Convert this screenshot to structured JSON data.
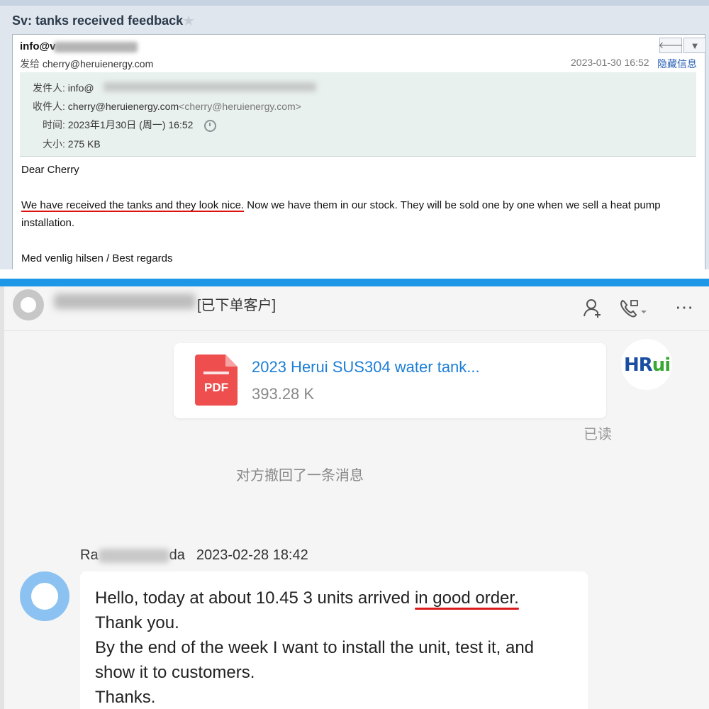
{
  "email": {
    "subject": "Sv: tanks received feedback",
    "from_addr_start": "info@v",
    "sender_label": "发给",
    "sender": "cherry@heruienergy.com",
    "datetime": "2023-01-30 16:52",
    "hide_info": "隐藏信息",
    "meta": {
      "from_label": "发件人:",
      "from_value": "info@",
      "to_label": "收件人:",
      "to_value": "cherry@heruienergy.com",
      "to_angle": "<cherry@heruienergy.com>",
      "time_label": "时间:",
      "time_value": "2023年1月30日 (周一) 16:52",
      "size_label": "大小:",
      "size_value": "275 KB"
    },
    "body": {
      "greeting": "Dear Cherry",
      "underlined": "We have received the tanks and they look nice.",
      "rest_line1": " Now we have them in our stock. They will be sold one by one when we sell a heat pump",
      "line2": "installation.",
      "signoff": "Med venlig hilsen / Best regards"
    }
  },
  "chat": {
    "customer_tag": "[已下单客户]",
    "file": {
      "icon_label": "PDF",
      "name": "2023 Herui SUS304 water tank...",
      "size": "393.28 K"
    },
    "logo": {
      "part1": "HR",
      "part2": "ui"
    },
    "read_status": "已读",
    "recall_notice": "对方撤回了一条消息",
    "sender_prefix": "Ra",
    "sender_suffix": "da",
    "timestamp": "2023-02-28 18:42",
    "message": {
      "line1_a": "Hello, today at about 10.45 3 units arrived ",
      "line1_b": "in good order.",
      "line2": "Thank you.",
      "line3": "By the end of the week I want to install the unit, test it, and",
      "line4": "show it to customers.",
      "line5": "Thanks."
    }
  }
}
